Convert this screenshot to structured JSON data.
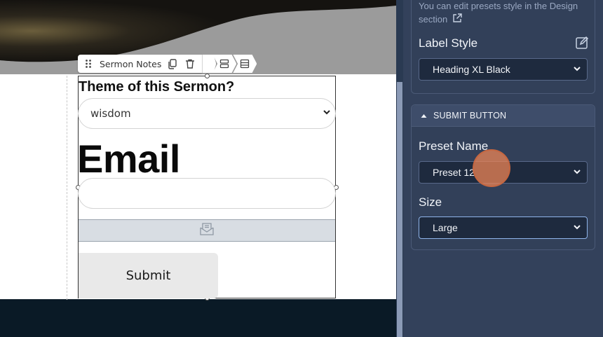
{
  "toolbar": {
    "block_name": "Sermon Notes"
  },
  "form": {
    "question_label": "Theme of this Sermon?",
    "select_value": "wisdom",
    "email_label": "Email",
    "email_value": "",
    "submit_label": "Submit"
  },
  "panel": {
    "note_line1": "You can edit presets style in the Design",
    "note_line2": "section",
    "label_style_title": "Label Style",
    "label_style_value": "Heading XL Black",
    "submit_section_title": "SUBMIT BUTTON",
    "preset_name_title": "Preset Name",
    "preset_name_value": "Preset 12",
    "size_title": "Size",
    "size_value": "Large"
  },
  "colors": {
    "panel_bg": "#33415b",
    "dropdown_bg": "#1e2a3e",
    "canvas_footer": "#0a1a26",
    "cursor_highlight": "#ec8456"
  }
}
